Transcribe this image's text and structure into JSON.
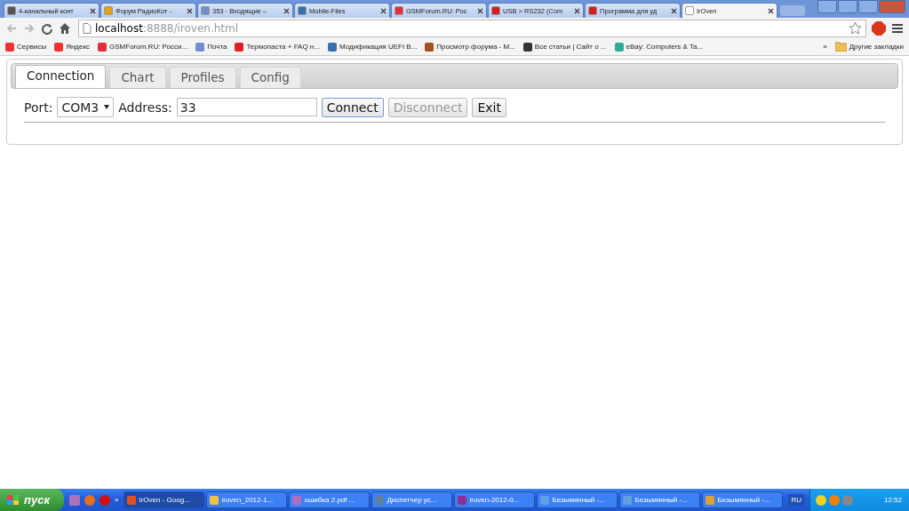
{
  "browser_tabs": [
    {
      "title": "4-канальный конт",
      "selected": false
    },
    {
      "title": "Форум РадиоКот -",
      "selected": false
    },
    {
      "title": "353 · Входящие –",
      "selected": false
    },
    {
      "title": "Mobile-Files",
      "selected": false
    },
    {
      "title": "GSMForum.RU: Рос",
      "selected": false
    },
    {
      "title": "USB > RS232 (Com",
      "selected": false
    },
    {
      "title": "Программа для уд",
      "selected": false
    },
    {
      "title": "IrOven",
      "selected": true
    }
  ],
  "address_bar": {
    "host": "localhost",
    "path": ":8888/iroven.html"
  },
  "bookmarks": [
    "Сервисы",
    "Яндекс",
    "GSMForum.RU: Росси...",
    "Почта",
    "Термопаста + FAQ н...",
    "Модификация UEFI B...",
    "Просмотр форума - M...",
    "Все статьи | Сайт о ...",
    "eBay: Computers & Ta..."
  ],
  "bookmarks_more": "»",
  "other_bookmarks": "Другие закладки",
  "app": {
    "tabs": [
      {
        "label": "Connection",
        "selected": true
      },
      {
        "label": "Chart",
        "selected": false
      },
      {
        "label": "Profiles",
        "selected": false
      },
      {
        "label": "Config",
        "selected": false
      }
    ],
    "port_label": "Port:",
    "port_value": "COM3",
    "address_label": "Address:",
    "address_value": "33",
    "buttons": [
      {
        "label": "Connect",
        "disabled": false,
        "focused": true
      },
      {
        "label": "Disconnect",
        "disabled": true,
        "focused": false
      },
      {
        "label": "Exit",
        "disabled": false,
        "focused": false
      }
    ]
  },
  "taskbar": {
    "start": "пуск",
    "quick_more": "»",
    "tasks": [
      {
        "title": "IrOven - Goog...",
        "selected": true
      },
      {
        "title": "iroven_2012-1...",
        "selected": false
      },
      {
        "title": "ошибка 2.pdf ...",
        "selected": false
      },
      {
        "title": "Диспетчер ус...",
        "selected": false
      },
      {
        "title": "iroven-2012-0...",
        "selected": false
      },
      {
        "title": "Безымянный -...",
        "selected": false
      },
      {
        "title": "Безымянный -...",
        "selected": false
      },
      {
        "title": "Безымянный -...",
        "selected": false
      }
    ],
    "language": "RU",
    "clock": "12:52"
  }
}
